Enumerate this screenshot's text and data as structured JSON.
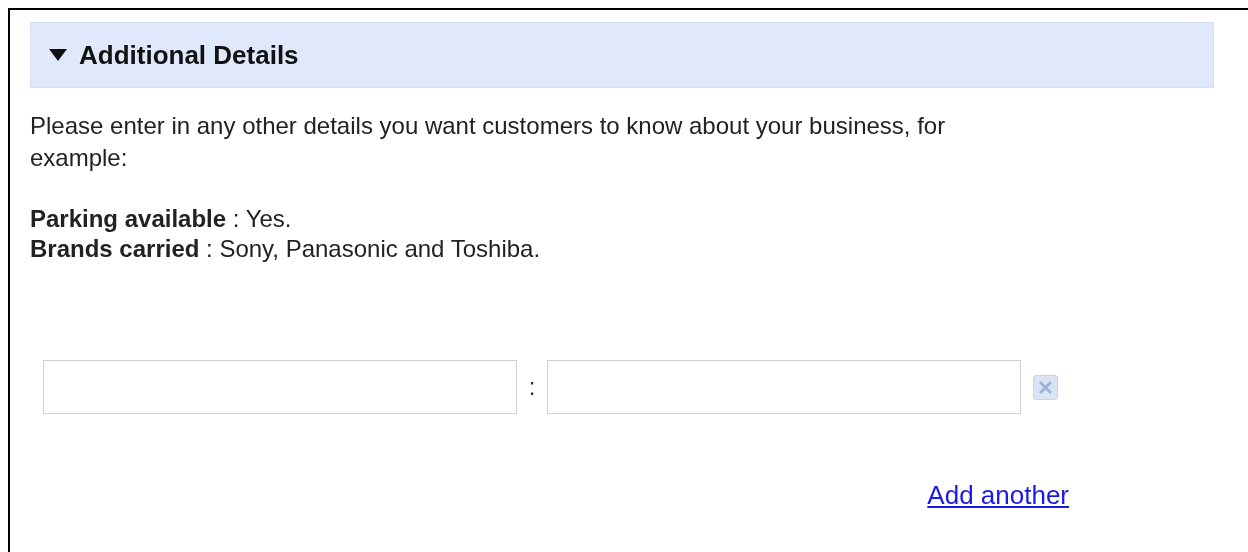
{
  "section": {
    "title": "Additional Details",
    "expanded": true
  },
  "intro": "Please enter in any other details you want customers to know about your business, for example:",
  "examples": [
    "**Parking available** : Yes.",
    "**Brands carried** : Sony, Panasonic and Toshiba."
  ],
  "fields": [
    {
      "separator": ":"
    }
  ],
  "add_link": "Add another"
}
